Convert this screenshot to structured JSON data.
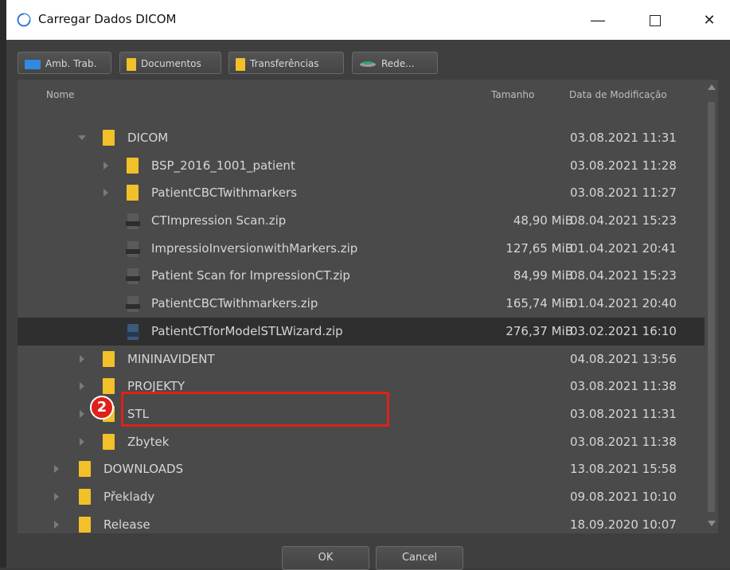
{
  "window": {
    "title": "Carregar Dados DICOM"
  },
  "toolbar": {
    "buttons": [
      {
        "label": "Amb. Trab.",
        "icon": "desktop-icon"
      },
      {
        "label": "Documentos",
        "icon": "folder-icon"
      },
      {
        "label": "Transferências",
        "icon": "folder-icon"
      },
      {
        "label": "Rede...",
        "icon": "network-icon"
      }
    ]
  },
  "columns": {
    "name": "Nome",
    "size": "Tamanho",
    "date": "Data de Modificação"
  },
  "rows": [
    {
      "name": "DICOM",
      "type": "folder",
      "expanded": true,
      "size": "",
      "date": "03.08.2021 11:31"
    },
    {
      "name": "BSP_2016_1001_patient",
      "type": "folder",
      "size": "",
      "date": "03.08.2021 11:28"
    },
    {
      "name": "PatientCBCTwithmarkers",
      "type": "folder",
      "size": "",
      "date": "03.08.2021 11:27"
    },
    {
      "name": "CTImpression Scan.zip",
      "type": "zip",
      "size": "48,90 MiB",
      "date": "08.04.2021 15:23"
    },
    {
      "name": "ImpressioInversionwithMarkers.zip",
      "type": "zip",
      "size": "127,65 MiB",
      "date": "01.04.2021 20:41"
    },
    {
      "name": "Patient Scan for ImpressionCT.zip",
      "type": "zip",
      "size": "84,99 MiB",
      "date": "08.04.2021 15:23"
    },
    {
      "name": "PatientCBCTwithmarkers.zip",
      "type": "zip",
      "size": "165,74 MiB",
      "date": "01.04.2021 20:40"
    },
    {
      "name": "PatientCTforModelSTLWizard.zip",
      "type": "zip",
      "selected": true,
      "size": "276,37 MiB",
      "date": "03.02.2021 16:10"
    },
    {
      "name": "MININAVIDENT",
      "type": "folder",
      "size": "",
      "date": "04.08.2021 13:56"
    },
    {
      "name": "PROJEKTY",
      "type": "folder",
      "size": "",
      "date": "03.08.2021 11:38"
    },
    {
      "name": "STL",
      "type": "folder",
      "size": "",
      "date": "03.08.2021 11:31"
    },
    {
      "name": "Zbytek",
      "type": "folder",
      "size": "",
      "date": "03.08.2021 11:38"
    },
    {
      "name": "DOWNLOADS",
      "type": "folder",
      "size": "",
      "date": "13.08.2021 15:58"
    },
    {
      "name": "Překlady",
      "type": "folder",
      "size": "",
      "date": "09.08.2021 10:10"
    },
    {
      "name": "Release",
      "type": "folder",
      "size": "",
      "date": "18.09.2020 10:07"
    }
  ],
  "annotation": {
    "step": "2",
    "color": "#e0201b"
  },
  "footer": {
    "ok": "OK",
    "cancel": "Cancel"
  },
  "colors": {
    "folder": "#f2c029",
    "selected_row": "#2f2f2f",
    "list_bg": "#4a4a4a"
  }
}
